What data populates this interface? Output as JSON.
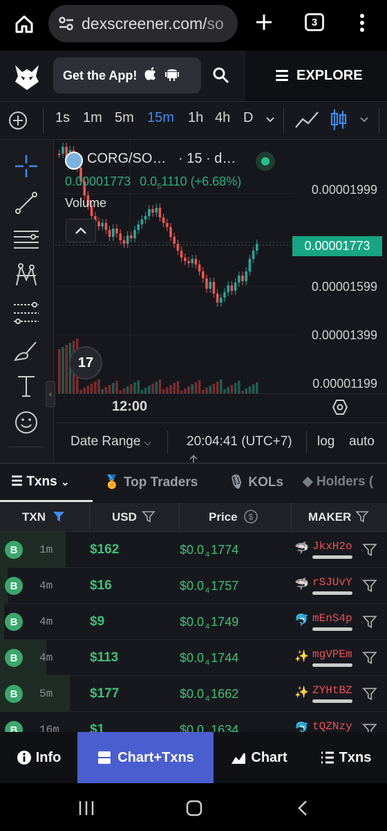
{
  "browser": {
    "url_main": "dexscreener.com/",
    "url_dim": "so",
    "tab_count": "3"
  },
  "header": {
    "get_app_label": "Get the App!",
    "explore_label": "EXPLORE"
  },
  "timeframes": [
    "1s",
    "1m",
    "5m",
    "15m",
    "1h",
    "4h",
    "D"
  ],
  "active_timeframe": "15m",
  "chart": {
    "pair_label": "CORG/SO…",
    "interval_label": "· 15 · d…",
    "ohlc_price": "0.00001773",
    "ohlc_change_prefix": "0.0",
    "ohlc_change_sub": "5",
    "ohlc_change_rest": "1110 (+6.68%)",
    "volume_label": "Volume",
    "price_labels": [
      "0.00001999",
      "0.00001599",
      "0.00001399",
      "0.00001199"
    ],
    "current_price": "0.00001773",
    "time_label": "12:00",
    "tv_logo": "17",
    "date_range_label": "Date Range",
    "clock": "20:04:41 (UTC+7)",
    "log_label": "log",
    "auto_label": "auto"
  },
  "chart_data": {
    "type": "candlestick",
    "y_axis_ticks": [
      1.199e-05,
      1.399e-05,
      1.599e-05,
      1.999e-05
    ],
    "last_price": 1.773e-05,
    "change_percent": 6.68,
    "x_tick": "12:00"
  },
  "tx_tabs": [
    {
      "label": "Txns",
      "icon": "list-icon"
    },
    {
      "label": "Top Traders",
      "icon": "medal-icon"
    },
    {
      "label": "KOLs",
      "icon": "mic-icon"
    },
    {
      "label": "Holders (",
      "icon": "diamond-icon"
    }
  ],
  "table": {
    "headers": [
      "TXN",
      "USD",
      "Price",
      "MAKER"
    ],
    "rows": [
      {
        "type": "B",
        "age": "1m",
        "usd": "$162",
        "price_pre": "$0.0",
        "price_sub": "4",
        "price_post": "1774",
        "maker": "JkxH2o",
        "icon": "🦈",
        "fill": 0.17
      },
      {
        "type": "B",
        "age": "4m",
        "usd": "$16",
        "price_pre": "$0.0",
        "price_sub": "4",
        "price_post": "1757",
        "maker": "rSJUvY",
        "icon": "🦈",
        "fill": 0.02
      },
      {
        "type": "B",
        "age": "4m",
        "usd": "$9",
        "price_pre": "$0.0",
        "price_sub": "4",
        "price_post": "1749",
        "maker": "mEnS4p",
        "icon": "🐬",
        "fill": 0.01
      },
      {
        "type": "B",
        "age": "4m",
        "usd": "$113",
        "price_pre": "$0.0",
        "price_sub": "4",
        "price_post": "1744",
        "maker": "mgVPEm",
        "icon": "✨",
        "fill": 0.12
      },
      {
        "type": "B",
        "age": "5m",
        "usd": "$177",
        "price_pre": "$0.0",
        "price_sub": "4",
        "price_post": "1662",
        "maker": "ZYHtBZ",
        "icon": "✨",
        "fill": 0.18
      },
      {
        "type": "B",
        "age": "16m",
        "usd": "$1",
        "price_pre": "$0.0",
        "price_sub": "4",
        "price_post": "1634",
        "maker": "tQZNzy",
        "icon": "🐬",
        "fill": 0.0
      }
    ]
  },
  "bottom_nav": {
    "info": "Info",
    "chart_txns": "Chart+Txns",
    "chart": "Chart",
    "txns": "Txns"
  },
  "colors": {
    "accent": "#3c8cf0",
    "buy_green": "#3bc17a",
    "sell_red": "#e8505b",
    "active_nav": "#4b5ed0",
    "price_tag": "#17a583"
  }
}
